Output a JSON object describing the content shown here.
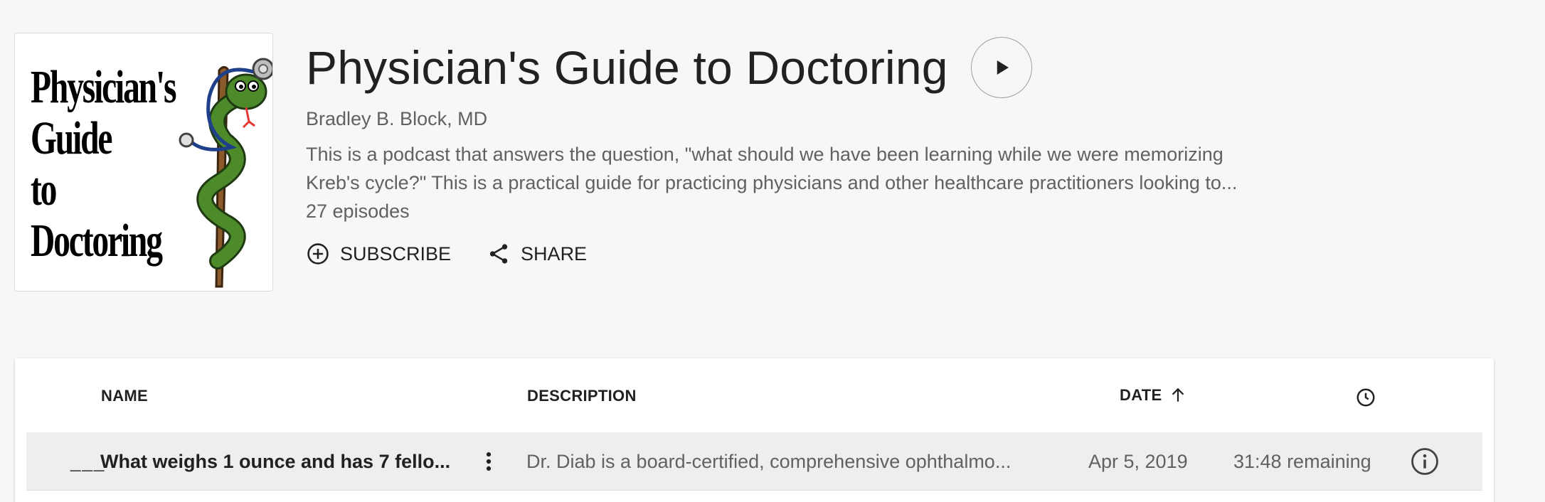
{
  "podcast": {
    "cover_text_lines": [
      "Physician's",
      "Guide",
      "to",
      "Doctoring"
    ],
    "title": "Physician's Guide to Doctoring",
    "author": "Bradley B. Block, MD",
    "description_line1": "This is a podcast that answers the question, \"what should we have been learning while we were memorizing",
    "description_line2": "Kreb's cycle?\" This is a practical guide for practicing physicians and other healthcare practitioners looking to...",
    "episode_count": "27 episodes"
  },
  "actions": {
    "subscribe_label": "SUBSCRIBE",
    "share_label": "SHARE"
  },
  "table": {
    "headers": {
      "name": "NAME",
      "description": "DESCRIPTION",
      "date": "DATE"
    },
    "rows": [
      {
        "status": "___",
        "name": "What weighs 1 ounce and has 7 fello...",
        "description": "Dr. Diab is a board-certified, comprehensive ophthalmo...",
        "date": "Apr 5, 2019",
        "remaining": "31:48 remaining"
      }
    ]
  },
  "icons": {
    "play": "play-icon",
    "subscribe": "add-circle-icon",
    "share": "share-icon",
    "sort": "arrow-up-icon",
    "duration": "clock-icon",
    "more": "more-vert-icon",
    "info": "info-icon"
  },
  "colors": {
    "background": "#f7f7f7",
    "primary_text": "#212121",
    "secondary_text": "#616161",
    "row_highlight": "#eeeeee"
  }
}
